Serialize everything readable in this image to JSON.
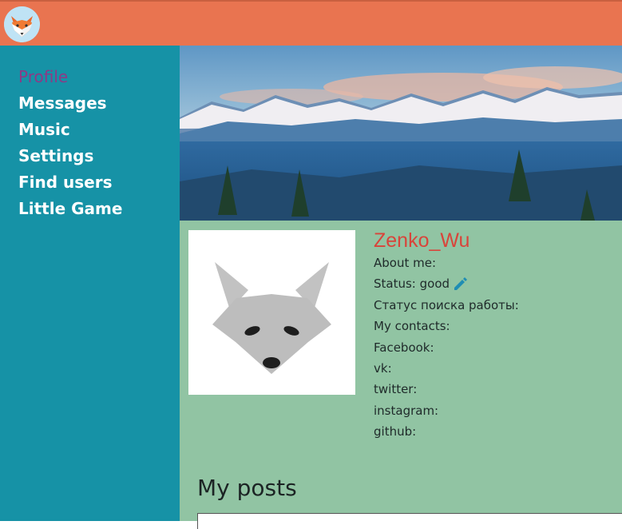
{
  "header": {
    "logo_icon": "fox-logo-icon",
    "bg_color": "#e97450"
  },
  "sidebar": {
    "bg_color": "#1692a6",
    "items": [
      {
        "label": "Profile",
        "active": true
      },
      {
        "label": "Messages",
        "active": false
      },
      {
        "label": "Music",
        "active": false
      },
      {
        "label": "Settings",
        "active": false
      },
      {
        "label": "Find users",
        "active": false
      },
      {
        "label": "Little Game",
        "active": false
      }
    ]
  },
  "profile": {
    "banner_icon": "mountain-landscape-image",
    "avatar_icon": "fox-avatar-icon",
    "username": "Zenko_Wu",
    "about_me": "About me:",
    "status": "Status: good",
    "status_edit_icon": "pencil-icon",
    "job_search": "Статус поиска работы:",
    "contacts": "My contacts:",
    "facebook": "Facebook:",
    "vk": "vk:",
    "twitter": "twitter:",
    "instagram": "instagram:",
    "github": "github:"
  },
  "posts": {
    "title": "My posts"
  }
}
